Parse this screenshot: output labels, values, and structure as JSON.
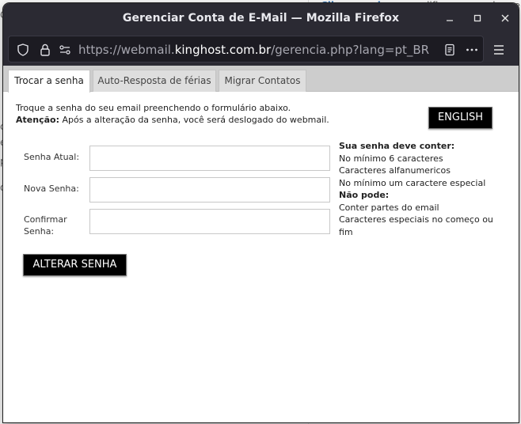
{
  "background": {
    "link_text": "Clique aqui",
    "trailing_text": " para modificar sua senha, re",
    "left_fragments": [
      "C",
      "c",
      "e",
      "p",
      "o"
    ]
  },
  "window": {
    "title": "Gerenciar Conta de E-Mail — Mozilla Firefox"
  },
  "urlbar": {
    "prefix": "https://webmail.",
    "domain": "kinghost.com.br",
    "path": "/gerencia.php?lang=pt_BR"
  },
  "tabs": [
    {
      "label": "Trocar a senha",
      "active": true
    },
    {
      "label": "Auto-Resposta de férias",
      "active": false
    },
    {
      "label": "Migrar Contatos",
      "active": false
    }
  ],
  "intro": {
    "line1": "Troque a senha do seu email preenchendo o formulário abaixo.",
    "attention_label": "Atenção:",
    "attention_text": " Após a alteração da senha, você será deslogado do webmail."
  },
  "english_button": "ENGLISH",
  "form": {
    "current_password_label": "Senha Atual:",
    "new_password_label": "Nova Senha:",
    "confirm_label_line1": "Confirmar",
    "confirm_label_line2": "Senha:",
    "current_password_value": "",
    "new_password_value": "",
    "confirm_password_value": "",
    "submit_label": "ALTERAR SENHA"
  },
  "rules": {
    "must_heading": "Sua senha deve conter:",
    "must_items": [
      "No mínimo 6 caracteres",
      "Caracteres alfanumericos",
      "No mínimo um caractere especial"
    ],
    "cannot_heading": "Não pode:",
    "cannot_items": [
      "Conter partes do email",
      "Caracteres especiais no começo ou fim"
    ]
  },
  "colors": {
    "titlebar": "#2b2a33",
    "urlbar": "#1c1b22",
    "button_bg": "#000000",
    "tab_strip": "#cdcdcd"
  }
}
